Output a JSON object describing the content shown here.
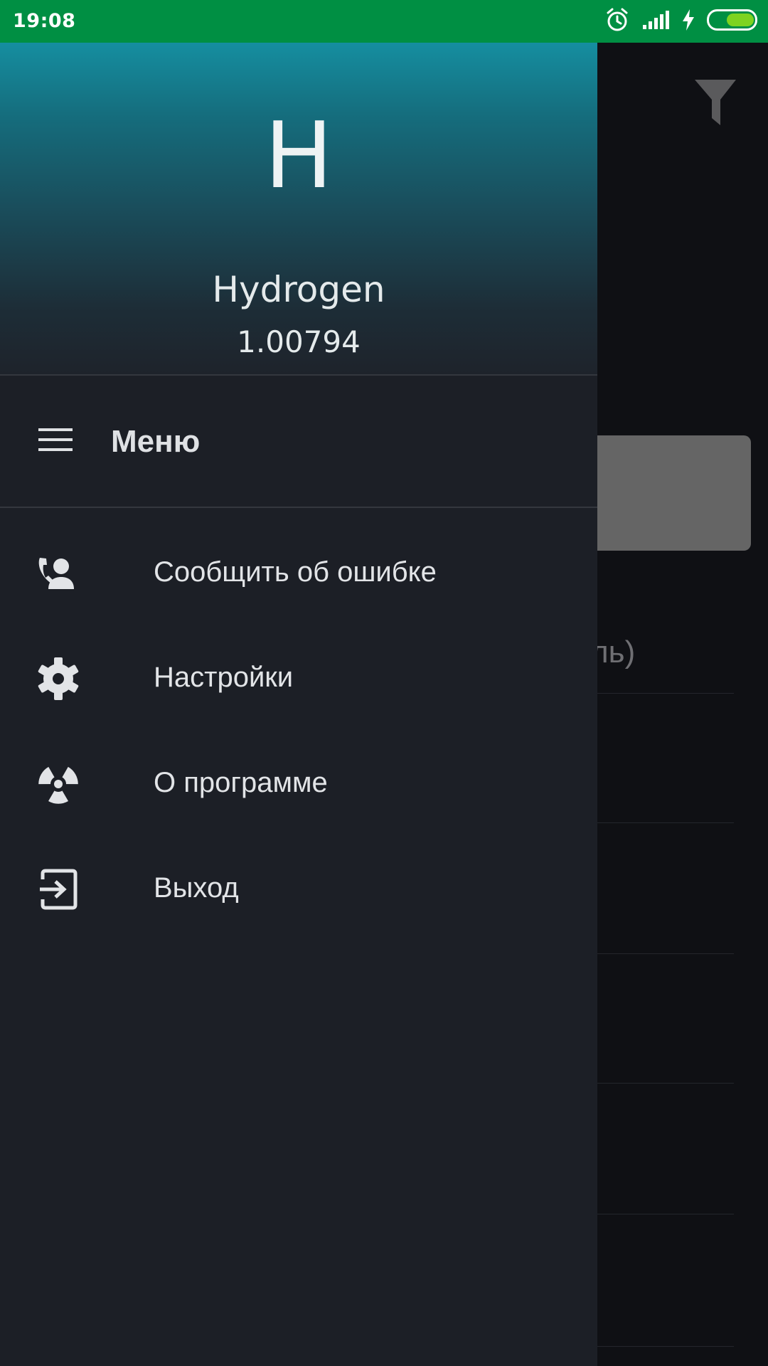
{
  "status_bar": {
    "time": "19:08",
    "icons": [
      "alarm-icon",
      "signal-icon",
      "charging-icon",
      "battery-icon"
    ],
    "color": "#008f43"
  },
  "drawer": {
    "header": {
      "symbol": "H",
      "name": "Hydrogen",
      "atomic_mass": "1.00794"
    },
    "menu_title": "Меню",
    "items": [
      {
        "label": "Сообщить об ошибке",
        "icon": "contact-phone-icon"
      },
      {
        "label": "Настройки",
        "icon": "gear-icon"
      },
      {
        "label": "О программе",
        "icon": "radiation-icon"
      },
      {
        "label": "Выход",
        "icon": "exit-icon"
      }
    ]
  },
  "background": {
    "partial_text": "ль)",
    "filter_icon": "filter-icon"
  }
}
